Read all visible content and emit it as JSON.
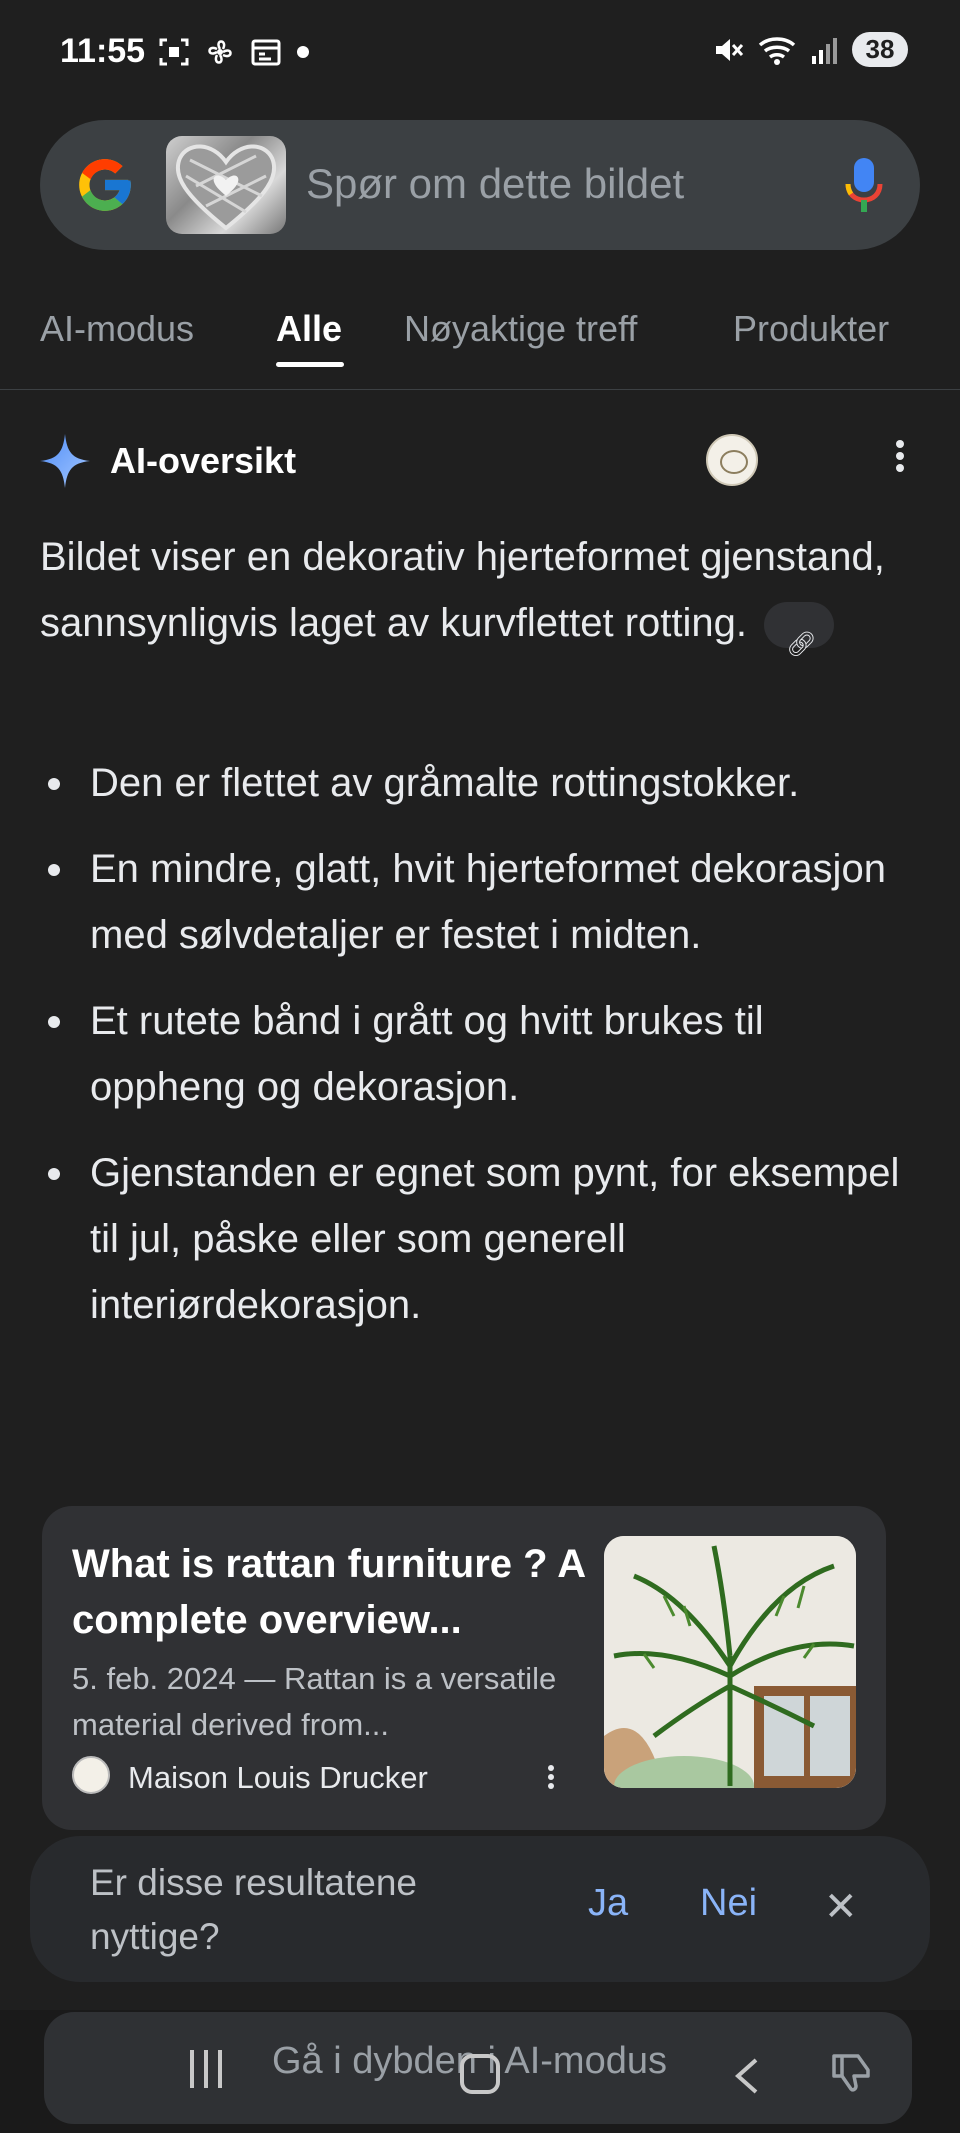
{
  "status_bar": {
    "time": "11:55",
    "battery": "38",
    "network": "5"
  },
  "search": {
    "placeholder": "Spør om dette bildet"
  },
  "tabs": [
    {
      "label": "AI-modus"
    },
    {
      "label": "Alle"
    },
    {
      "label": "Nøyaktige treff"
    },
    {
      "label": "Produkter"
    }
  ],
  "ai_overview": {
    "title": "AI-oversikt",
    "summary": "Bildet viser en dekorativ hjerteformet gjenstand, sannsynligvis laget av kurvflettet rotting.",
    "bullets": [
      "Den er flettet av gråmalte rottingstokker.",
      "En mindre, glatt, hvit hjerteformet dekorasjon med sølvdetaljer er festet i midten.",
      "Et rutete bånd i grått og hvitt brukes til oppheng og dekorasjon.",
      "Gjenstanden er egnet som pynt, for eksempel til jul, påske eller som generell interiørdekorasjon."
    ]
  },
  "source_card": {
    "title": "What is rattan furniture ? A complete overview...",
    "snippet": "5. feb. 2024 — Rattan is a versatile material derived from...",
    "source": "Maison Louis Drucker"
  },
  "feedback": {
    "question": "Er disse resultatene nyttige?",
    "yes": "Ja",
    "no": "Nei"
  },
  "bottom": {
    "deep_dive": "Gå i dybden i AI-modus"
  },
  "colors": {
    "background": "#1f1f1f",
    "accent": "#8ab4f8",
    "surface": "#303134"
  }
}
